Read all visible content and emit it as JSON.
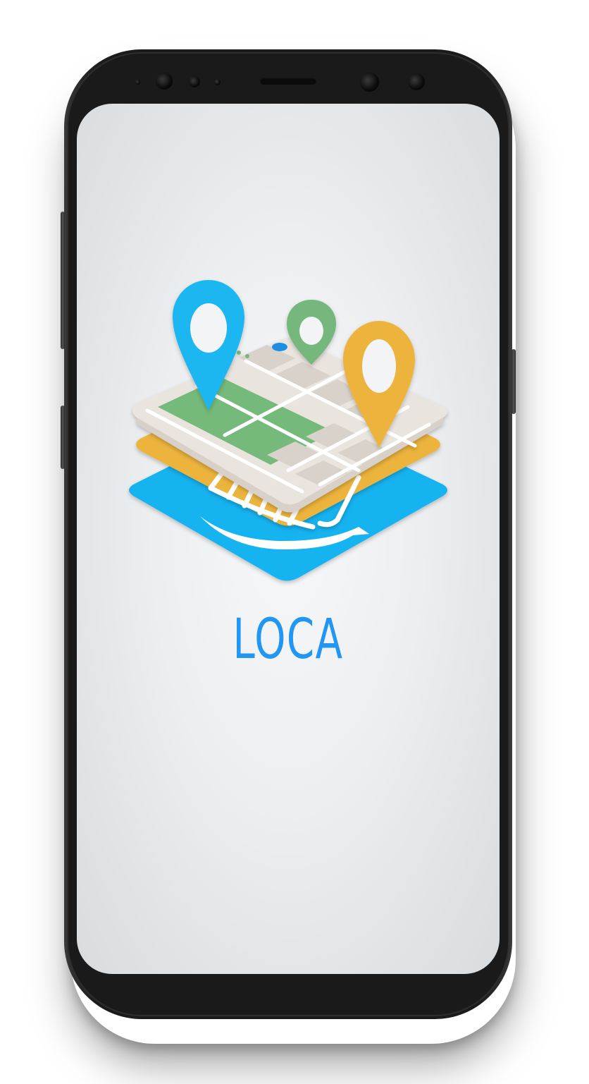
{
  "app": {
    "name": "LOCA",
    "logo_icon": "map-layers-location-icon"
  },
  "colors": {
    "title": "#2196f3",
    "pin_blue": "#1ab6f0",
    "pin_green": "#74b77b",
    "pin_yellow": "#ecb43c",
    "layer_yellow": "#ecb43c",
    "layer_blue": "#16b3f1",
    "map_park": "#75ba7a",
    "map_ground": "#e8e3dc"
  }
}
